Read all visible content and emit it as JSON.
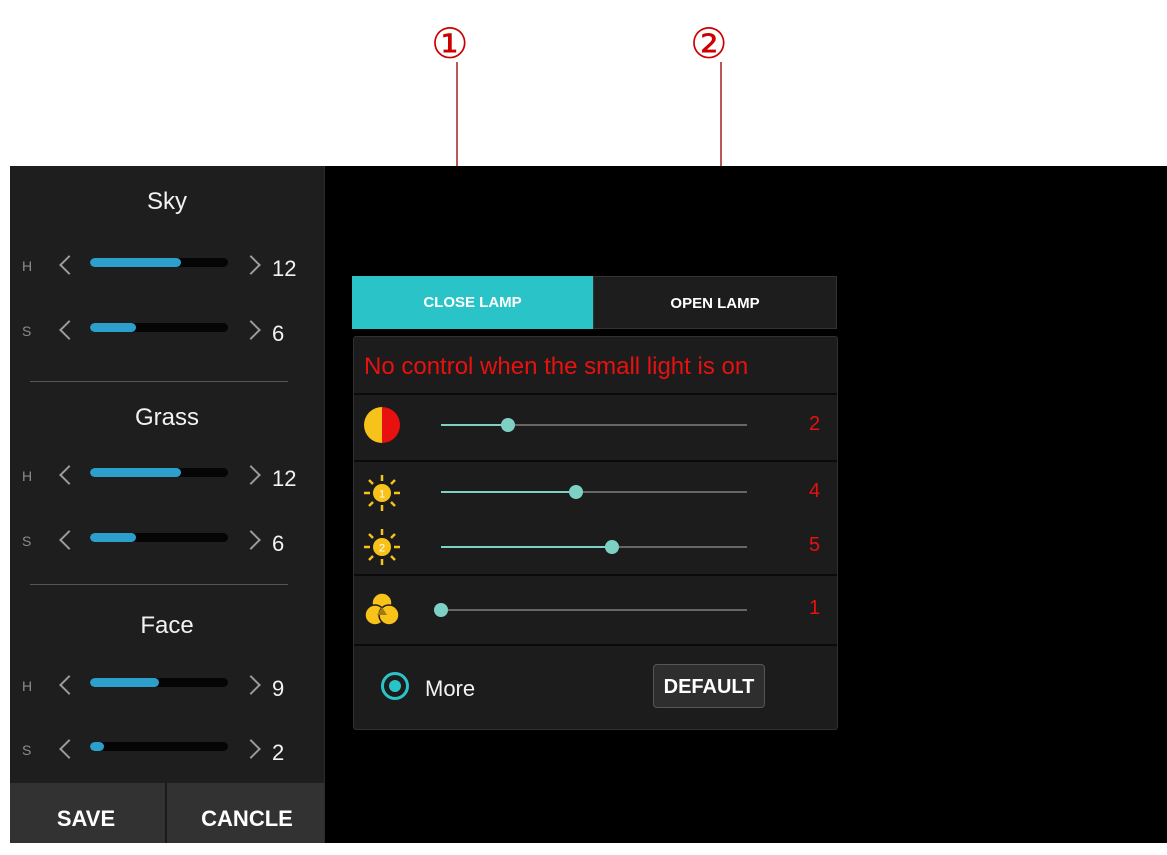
{
  "callouts": [
    {
      "label": "①"
    },
    {
      "label": "②"
    }
  ],
  "left_panel": {
    "sections": [
      {
        "title": "Sky",
        "rows": [
          {
            "label": "H",
            "value": "12",
            "level": 0.66
          },
          {
            "label": "S",
            "value": "6",
            "level": 0.33
          }
        ]
      },
      {
        "title": "Grass",
        "rows": [
          {
            "label": "H",
            "value": "12",
            "level": 0.66
          },
          {
            "label": "S",
            "value": "6",
            "level": 0.33
          }
        ]
      },
      {
        "title": "Face",
        "rows": [
          {
            "label": "H",
            "value": "9",
            "level": 0.5
          },
          {
            "label": "S",
            "value": "2",
            "level": 0.1
          }
        ]
      }
    ],
    "save_label": "SAVE",
    "cancel_label": "CANCLE"
  },
  "tabs": {
    "close": "CLOSE LAMP",
    "open": "OPEN LAMP",
    "active": "close",
    "accent": "#2ac4c8"
  },
  "control_panel": {
    "warning": "No control when the small light is on",
    "warning_color": "#e8110f",
    "sliders": [
      {
        "icon": "contrast-icon",
        "value": "2",
        "level": 0.22
      },
      {
        "icon": "brightness-1-icon",
        "value": "4",
        "level": 0.44
      },
      {
        "icon": "brightness-2-icon",
        "value": "5",
        "level": 0.56
      },
      {
        "icon": "color-mix-icon",
        "value": "1",
        "level": 0.0
      }
    ],
    "more_label": "More",
    "default_label": "DEFAULT"
  }
}
